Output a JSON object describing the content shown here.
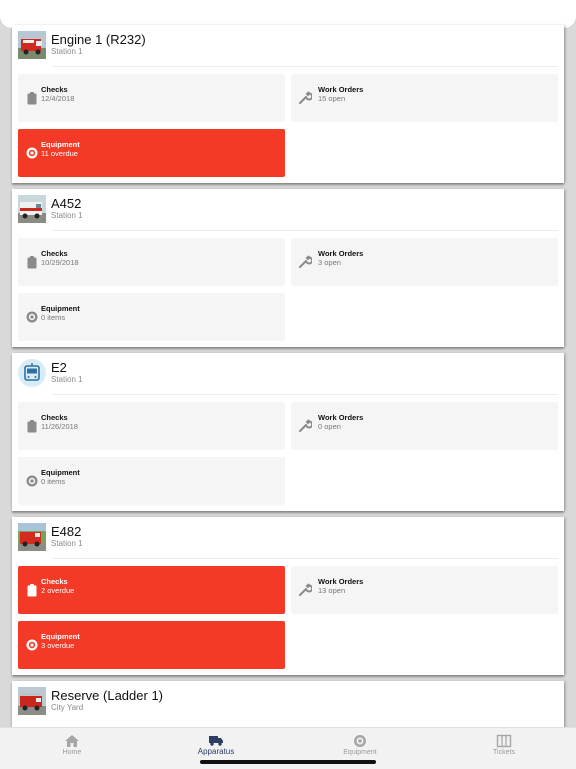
{
  "apparatus": [
    {
      "name": "Engine 1 (R232)",
      "station": "Station 1",
      "thumb": "fire-truck-photo",
      "checks": {
        "label": "Checks",
        "value": "12/4/2018",
        "alert": false
      },
      "work_orders": {
        "label": "Work Orders",
        "value": "15 open"
      },
      "equipment": {
        "label": "Equipment",
        "value": "11 overdue",
        "alert": true
      }
    },
    {
      "name": "A452",
      "station": "Station 1",
      "thumb": "ambulance-photo",
      "checks": {
        "label": "Checks",
        "value": "10/29/2018",
        "alert": false
      },
      "work_orders": {
        "label": "Work Orders",
        "value": "3 open"
      },
      "equipment": {
        "label": "Equipment",
        "value": "0 items",
        "alert": false
      }
    },
    {
      "name": "E2",
      "station": "Station 1",
      "thumb": "bus-icon",
      "checks": {
        "label": "Checks",
        "value": "11/26/2018",
        "alert": false
      },
      "work_orders": {
        "label": "Work Orders",
        "value": "0 open"
      },
      "equipment": {
        "label": "Equipment",
        "value": "0 items",
        "alert": false
      }
    },
    {
      "name": "E482",
      "station": "Station 1",
      "thumb": "fire-engine-photo",
      "checks": {
        "label": "Checks",
        "value": "2 overdue",
        "alert": true
      },
      "work_orders": {
        "label": "Work Orders",
        "value": "13 open"
      },
      "equipment": {
        "label": "Equipment",
        "value": "3 overdue",
        "alert": true
      }
    },
    {
      "name": "Reserve (Ladder 1)",
      "station": "City Yard",
      "thumb": "ladder-truck-photo"
    }
  ],
  "tabs": [
    {
      "label": "Home",
      "icon": "home-icon",
      "active": false
    },
    {
      "label": "Apparatus",
      "icon": "truck-icon",
      "active": true
    },
    {
      "label": "Equipment",
      "icon": "gear-icon",
      "active": false
    },
    {
      "label": "Tickets",
      "icon": "tickets-icon",
      "active": false
    }
  ],
  "colors": {
    "alert": "#f23a26",
    "tile": "#f5f5f5",
    "active_tab": "#2c3e66",
    "inactive_tab": "#9a9a9a"
  }
}
